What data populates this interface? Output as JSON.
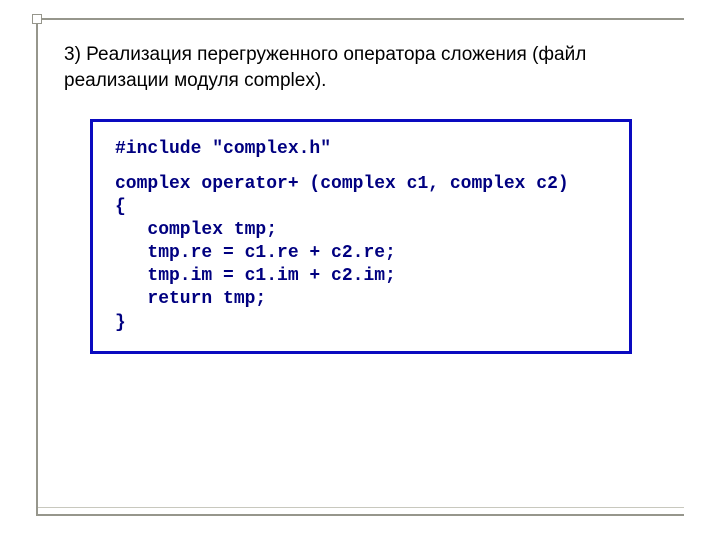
{
  "title": "3) Реализация перегруженного оператора сложения (файл реализации модуля complex).",
  "code": {
    "l1": "#include \"complex.h\"",
    "l2": "complex operator+ (complex c1, complex c2)",
    "l3": "{",
    "l4": "   complex tmp;",
    "l5": "   tmp.re = c1.re + c2.re;",
    "l6": "   tmp.im = c1.im + c2.im;",
    "l7": "   return tmp;",
    "l8": "}"
  }
}
